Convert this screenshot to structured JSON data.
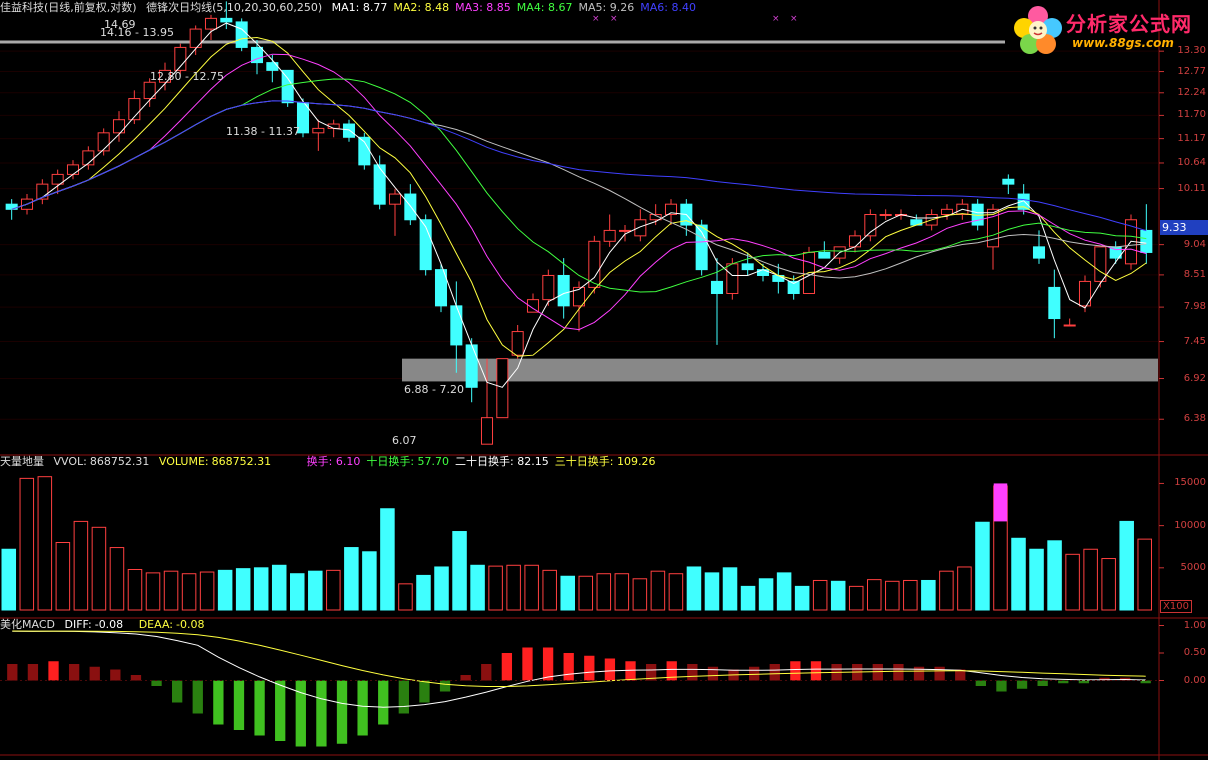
{
  "header": {
    "stock": "佳益科技(日线,前复权,对数)",
    "indicator": "德锋次日均线(5,10,20,30,60,250)",
    "ma": [
      {
        "label": "MA1:",
        "value": "8.77",
        "color": "#ffffff"
      },
      {
        "label": "MA2:",
        "value": "8.48",
        "color": "#ffff40"
      },
      {
        "label": "MA3:",
        "value": "8.85",
        "color": "#ff40ff"
      },
      {
        "label": "MA4:",
        "value": "8.67",
        "color": "#40ff40"
      },
      {
        "label": "MA5:",
        "value": "9.26",
        "color": "#c0c0c0"
      },
      {
        "label": "MA6:",
        "value": "8.40",
        "color": "#4040ff"
      }
    ]
  },
  "logo": {
    "title": "分析家公式网",
    "url": "www.88gs.com"
  },
  "price_axis": {
    "ticks": [
      "13.30",
      "12.77",
      "12.24",
      "11.70",
      "11.17",
      "10.64",
      "10.11",
      "9.04",
      "8.51",
      "7.98",
      "7.45",
      "6.92",
      "6.38"
    ],
    "last": "9.33"
  },
  "annotations": {
    "high1": "14.69",
    "range1": "14.16 - 13.95",
    "range2": "12.80 - 12.75",
    "range3": "11.38 - 11.37",
    "gap": "6.88 - 7.20",
    "low": "6.07"
  },
  "volume": {
    "title": "天量地量",
    "vol_label": "VVOL:",
    "vol_value": "868752.31",
    "volume_label": "VOLUME:",
    "volume_value": "868752.31",
    "turnover": [
      {
        "label": "换手:",
        "value": "6.10",
        "color": "#ff40ff"
      },
      {
        "label": "十日换手:",
        "value": "57.70",
        "color": "#40ff40"
      },
      {
        "label": "二十日换手:",
        "value": "82.15",
        "color": "#ffffff"
      },
      {
        "label": "三十日换手:",
        "value": "109.26",
        "color": "#ffff40"
      }
    ],
    "ticks": [
      "15000",
      "10000",
      "5000"
    ],
    "unit": "X100"
  },
  "macd": {
    "title": "美化MACD",
    "diff_label": "DIFF:",
    "diff_value": "-0.08",
    "dea_label": "DEAA:",
    "dea_value": "-0.08",
    "ticks": [
      "1.00",
      "0.50",
      "0.00"
    ]
  },
  "colors": {
    "up": "#ff4040",
    "down": "#40ffff",
    "grid": "#8b1010",
    "bg": "#000000"
  },
  "chart_data": {
    "type": "candlestick",
    "title": "佳益科技(日线,前复权,对数)",
    "candles": [
      [
        9.8,
        9.9,
        9.5,
        9.7
      ],
      [
        9.7,
        10.0,
        9.6,
        9.9
      ],
      [
        9.9,
        10.3,
        9.8,
        10.2
      ],
      [
        10.2,
        10.5,
        10.0,
        10.4
      ],
      [
        10.4,
        10.7,
        10.3,
        10.6
      ],
      [
        10.6,
        11.0,
        10.5,
        10.9
      ],
      [
        10.9,
        11.4,
        10.8,
        11.3
      ],
      [
        11.3,
        11.8,
        11.1,
        11.6
      ],
      [
        11.6,
        12.3,
        11.5,
        12.1
      ],
      [
        12.1,
        12.6,
        11.9,
        12.5
      ],
      [
        12.5,
        13.0,
        12.3,
        12.8
      ],
      [
        12.8,
        13.5,
        12.7,
        13.4
      ],
      [
        13.4,
        14.0,
        13.2,
        13.9
      ],
      [
        13.9,
        14.3,
        13.6,
        14.2
      ],
      [
        14.2,
        14.69,
        13.9,
        14.1
      ],
      [
        14.1,
        14.2,
        13.3,
        13.4
      ],
      [
        13.4,
        13.6,
        12.7,
        13.0
      ],
      [
        13.0,
        13.2,
        12.5,
        12.8
      ],
      [
        12.8,
        12.8,
        11.9,
        12.0
      ],
      [
        12.0,
        12.1,
        11.2,
        11.3
      ],
      [
        11.3,
        11.6,
        10.9,
        11.4
      ],
      [
        11.4,
        11.6,
        11.2,
        11.5
      ],
      [
        11.5,
        11.6,
        11.1,
        11.2
      ],
      [
        11.2,
        11.3,
        10.5,
        10.6
      ],
      [
        10.6,
        10.8,
        9.7,
        9.8
      ],
      [
        9.8,
        10.1,
        9.2,
        10.0
      ],
      [
        10.0,
        10.2,
        9.4,
        9.5
      ],
      [
        9.5,
        9.6,
        8.5,
        8.6
      ],
      [
        8.6,
        8.7,
        7.9,
        8.0
      ],
      [
        8.0,
        8.4,
        7.0,
        7.4
      ],
      [
        7.4,
        7.5,
        6.6,
        6.8
      ],
      [
        6.07,
        7.2,
        6.07,
        6.4
      ],
      [
        6.4,
        7.2,
        6.4,
        7.2
      ],
      [
        7.25,
        7.7,
        7.2,
        7.6
      ],
      [
        7.9,
        8.2,
        7.9,
        8.1
      ],
      [
        8.1,
        8.6,
        8.0,
        8.5
      ],
      [
        8.5,
        8.8,
        7.8,
        8.0
      ],
      [
        8.0,
        8.4,
        7.6,
        8.3
      ],
      [
        8.3,
        9.2,
        8.2,
        9.1
      ],
      [
        9.1,
        9.6,
        9.0,
        9.3
      ],
      [
        9.3,
        9.4,
        9.1,
        9.3
      ],
      [
        9.2,
        9.7,
        9.1,
        9.5
      ],
      [
        9.5,
        9.8,
        9.4,
        9.6
      ],
      [
        9.6,
        9.9,
        9.4,
        9.8
      ],
      [
        9.8,
        9.9,
        9.2,
        9.4
      ],
      [
        9.4,
        9.5,
        8.5,
        8.6
      ],
      [
        8.4,
        8.8,
        7.4,
        8.2
      ],
      [
        8.2,
        8.8,
        8.1,
        8.7
      ],
      [
        8.7,
        8.9,
        8.5,
        8.6
      ],
      [
        8.6,
        8.7,
        8.4,
        8.5
      ],
      [
        8.5,
        8.7,
        8.2,
        8.4
      ],
      [
        8.4,
        8.5,
        8.1,
        8.2
      ],
      [
        8.2,
        9.0,
        8.2,
        8.9
      ],
      [
        8.9,
        9.1,
        8.8,
        8.8
      ],
      [
        8.8,
        9.0,
        8.7,
        9.0
      ],
      [
        9.0,
        9.3,
        8.9,
        9.2
      ],
      [
        9.2,
        9.7,
        9.1,
        9.6
      ],
      [
        9.6,
        9.7,
        9.5,
        9.6
      ],
      [
        9.6,
        9.7,
        9.5,
        9.6
      ],
      [
        9.5,
        9.6,
        9.4,
        9.4
      ],
      [
        9.4,
        9.7,
        9.3,
        9.6
      ],
      [
        9.6,
        9.8,
        9.5,
        9.7
      ],
      [
        9.6,
        9.9,
        9.5,
        9.8
      ],
      [
        9.8,
        9.9,
        9.3,
        9.4
      ],
      [
        9.0,
        9.8,
        8.6,
        9.7
      ],
      [
        10.3,
        10.4,
        10.0,
        10.2
      ],
      [
        10.0,
        10.2,
        9.6,
        9.7
      ],
      [
        9.0,
        9.3,
        8.7,
        8.8
      ],
      [
        8.3,
        8.6,
        7.5,
        7.8
      ],
      [
        7.7,
        7.8,
        7.7,
        7.7
      ],
      [
        8.0,
        8.5,
        7.9,
        8.4
      ],
      [
        8.4,
        9.0,
        8.3,
        9.0
      ],
      [
        9.0,
        9.1,
        8.7,
        8.8
      ],
      [
        8.7,
        9.6,
        8.6,
        9.5
      ],
      [
        9.3,
        9.8,
        8.7,
        8.9
      ]
    ],
    "volume": [
      7200,
      15600,
      15800,
      8000,
      10500,
      9800,
      7400,
      4800,
      4400,
      4600,
      4300,
      4500,
      4700,
      4900,
      5000,
      5300,
      4300,
      4600,
      4700,
      7400,
      6900,
      12000,
      3100,
      4100,
      5100,
      9300,
      5300,
      5200,
      5300,
      5300,
      4700,
      4000,
      4000,
      4300,
      4300,
      3700,
      4600,
      4300,
      5100,
      4400,
      5000,
      2800,
      3700,
      4400,
      2800,
      3500,
      3400,
      2800,
      3600,
      3400,
      3500,
      3500,
      4600,
      5100,
      10400,
      14700,
      8500,
      7200,
      8200,
      6600,
      7200,
      6100,
      10500,
      8400
    ],
    "macd": [
      0.3,
      0.3,
      0.35,
      0.3,
      0.25,
      0.2,
      0.1,
      -0.1,
      -0.4,
      -0.6,
      -0.8,
      -0.9,
      -1.0,
      -1.1,
      -1.2,
      -1.2,
      -1.15,
      -1.0,
      -0.8,
      -0.6,
      -0.4,
      -0.2,
      0.1,
      0.3,
      0.5,
      0.6,
      0.6,
      0.5,
      0.45,
      0.4,
      0.35,
      0.3,
      0.35,
      0.3,
      0.25,
      0.2,
      0.25,
      0.3,
      0.35,
      0.35,
      0.3,
      0.3,
      0.3,
      0.3,
      0.25,
      0.25,
      0.2,
      -0.1,
      -0.2,
      -0.15,
      -0.1,
      -0.05,
      -0.05,
      0.05,
      0.05,
      -0.05
    ]
  }
}
